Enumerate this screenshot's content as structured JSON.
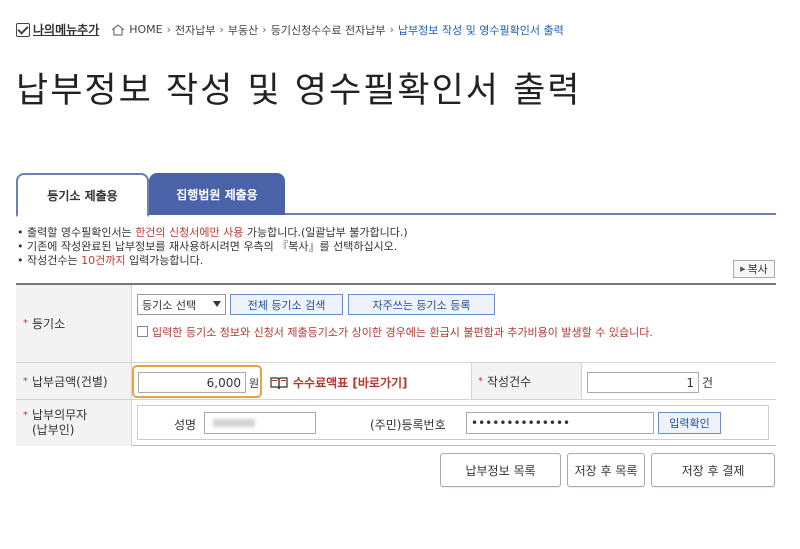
{
  "breadcrumb": {
    "my_menu_label": "나의메뉴추가",
    "items": [
      "HOME",
      "전자납부",
      "부동산",
      "등기신청수수료 전자납부"
    ],
    "current": "납부정보 작성 및 영수필확인서 출력"
  },
  "page_title": "납부정보 작성 및 영수필확인서 출력",
  "tabs": [
    {
      "label": "등기소 제출용",
      "active": true
    },
    {
      "label": "집행법원 제출용",
      "active": false
    }
  ],
  "notices": {
    "line1_pre": "• 출력할 영수필확인서는 ",
    "line1_red": "한건의 신청서에만 사용",
    "line1_post": " 가능합니다.(일괄납부 불가합니다.)",
    "line2": "• 기존에 작성완료된 납부정보를 재사용하시려면 우측의 『복사』를 선택하십시오.",
    "line3_pre": "• 작성건수는 ",
    "line3_red": "10건까지",
    "line3_post": " 입력가능합니다."
  },
  "copy_button": "복사",
  "form": {
    "registry_label": "등기소",
    "registry_select_value": "등기소 선택",
    "search_all_button": "전체 등기소 검색",
    "frequent_button": "자주쓰는 등기소 등록",
    "agree_text": "입력한 등기소 정보와 신청서 제출등기소가 상이한 경우에는 환급시 불편함과 추가비용이 발생할 수 있습니다.",
    "amount_label": "납부금액(건별)",
    "amount_value": "6,000",
    "amount_unit": "원",
    "fee_table_link": "수수료액표 [바로가기]",
    "count_label": "작성건수",
    "count_value": "1",
    "count_unit": "건",
    "payer_label_1": "납부의무자",
    "payer_label_2": "(납부인)",
    "name_label": "성명",
    "reg_no_label": "(주민)등록번호",
    "reg_no_value": "••••••••••••••",
    "confirm_button": "입력확인"
  },
  "actions": {
    "list": "납부정보 목록",
    "save_list": "저장 후 목록",
    "save_pay": "저장 후 결제"
  },
  "colors": {
    "accent_blue": "#4a63a8",
    "required_red": "#c0392b",
    "highlight_orange": "#f0a040",
    "link_blue": "#1e5fb3"
  }
}
